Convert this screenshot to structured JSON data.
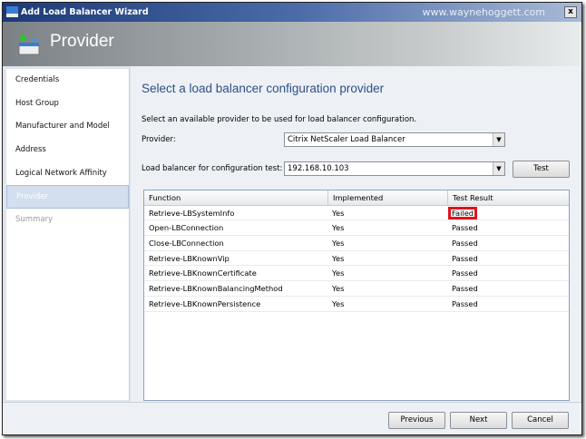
{
  "window": {
    "title": "Add Load Balancer Wizard",
    "watermark": "www.waynehoggett.com",
    "close_label": "x"
  },
  "header": {
    "title": "Provider"
  },
  "sidebar": {
    "items": [
      {
        "label": "Credentials"
      },
      {
        "label": "Host Group"
      },
      {
        "label": "Manufacturer and Model"
      },
      {
        "label": "Address"
      },
      {
        "label": "Logical Network Affinity"
      },
      {
        "label": "Provider"
      },
      {
        "label": "Summary"
      }
    ]
  },
  "main": {
    "title": "Select a load balancer configuration provider",
    "description": "Select an available provider to be used for load balancer configuration.",
    "provider_label": "Provider:",
    "provider_value": "Citrix NetScaler Load Balancer",
    "lb_label": "Load balancer for configuration test:",
    "lb_value": "192.168.10.103",
    "test_button": "Test",
    "table": {
      "headers": [
        "Function",
        "Implemented",
        "Test Result"
      ],
      "rows": [
        [
          "Retrieve-LBSystemInfo",
          "Yes",
          "Failed"
        ],
        [
          "Open-LBConnection",
          "Yes",
          "Passed"
        ],
        [
          "Close-LBConnection",
          "Yes",
          "Passed"
        ],
        [
          "Retrieve-LBKnownVip",
          "Yes",
          "Passed"
        ],
        [
          "Retrieve-LBKnownCertificate",
          "Yes",
          "Passed"
        ],
        [
          "Retrieve-LBKnownBalancingMethod",
          "Yes",
          "Passed"
        ],
        [
          "Retrieve-LBKnownPersistence",
          "Yes",
          "Passed"
        ]
      ]
    }
  },
  "footer": {
    "previous": "Previous",
    "next": "Next",
    "cancel": "Cancel"
  },
  "colors": {
    "highlight": "#e0141c",
    "title": "#2e4f86"
  }
}
